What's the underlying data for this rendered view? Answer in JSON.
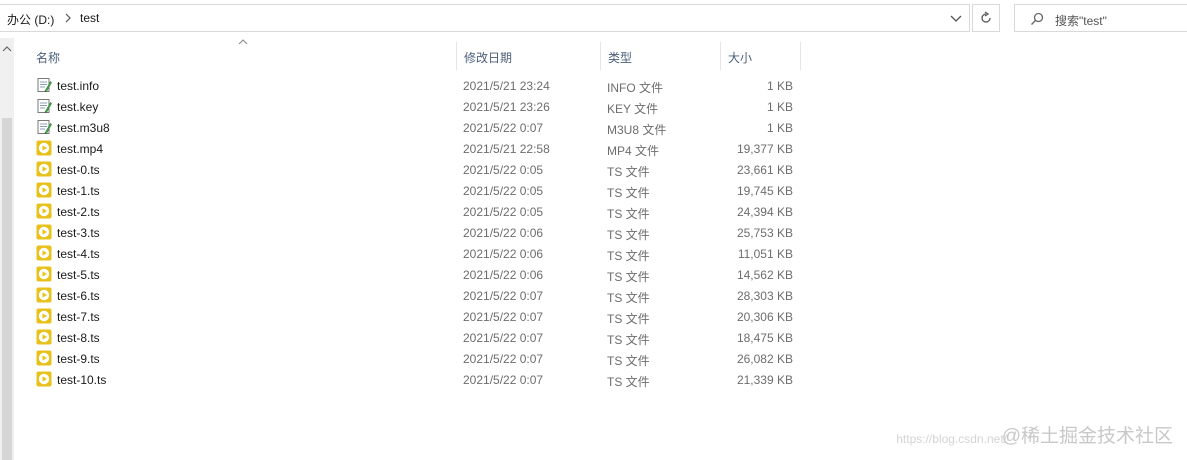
{
  "address_bar": {
    "crumbs": [
      "办公 (D:)",
      "test"
    ]
  },
  "search": {
    "placeholder": "搜索\"test\""
  },
  "columns": {
    "name": "名称",
    "date": "修改日期",
    "type": "类型",
    "size": "大小"
  },
  "files": [
    {
      "name": "test.info",
      "date": "2021/5/21 23:24",
      "type": "INFO 文件",
      "size": "1 KB",
      "icon": "text-file-icon"
    },
    {
      "name": "test.key",
      "date": "2021/5/21 23:26",
      "type": "KEY 文件",
      "size": "1 KB",
      "icon": "text-file-icon"
    },
    {
      "name": "test.m3u8",
      "date": "2021/5/22 0:07",
      "type": "M3U8 文件",
      "size": "1 KB",
      "icon": "text-file-icon"
    },
    {
      "name": "test.mp4",
      "date": "2021/5/21 22:58",
      "type": "MP4 文件",
      "size": "19,377 KB",
      "icon": "video-file-icon"
    },
    {
      "name": "test-0.ts",
      "date": "2021/5/22 0:05",
      "type": "TS 文件",
      "size": "23,661 KB",
      "icon": "video-file-icon"
    },
    {
      "name": "test-1.ts",
      "date": "2021/5/22 0:05",
      "type": "TS 文件",
      "size": "19,745 KB",
      "icon": "video-file-icon"
    },
    {
      "name": "test-2.ts",
      "date": "2021/5/22 0:05",
      "type": "TS 文件",
      "size": "24,394 KB",
      "icon": "video-file-icon"
    },
    {
      "name": "test-3.ts",
      "date": "2021/5/22 0:06",
      "type": "TS 文件",
      "size": "25,753 KB",
      "icon": "video-file-icon"
    },
    {
      "name": "test-4.ts",
      "date": "2021/5/22 0:06",
      "type": "TS 文件",
      "size": "11,051 KB",
      "icon": "video-file-icon"
    },
    {
      "name": "test-5.ts",
      "date": "2021/5/22 0:06",
      "type": "TS 文件",
      "size": "14,562 KB",
      "icon": "video-file-icon"
    },
    {
      "name": "test-6.ts",
      "date": "2021/5/22 0:07",
      "type": "TS 文件",
      "size": "28,303 KB",
      "icon": "video-file-icon"
    },
    {
      "name": "test-7.ts",
      "date": "2021/5/22 0:07",
      "type": "TS 文件",
      "size": "20,306 KB",
      "icon": "video-file-icon"
    },
    {
      "name": "test-8.ts",
      "date": "2021/5/22 0:07",
      "type": "TS 文件",
      "size": "18,475 KB",
      "icon": "video-file-icon"
    },
    {
      "name": "test-9.ts",
      "date": "2021/5/22 0:07",
      "type": "TS 文件",
      "size": "26,082 KB",
      "icon": "video-file-icon"
    },
    {
      "name": "test-10.ts",
      "date": "2021/5/22 0:07",
      "type": "TS 文件",
      "size": "21,339 KB",
      "icon": "video-file-icon"
    }
  ],
  "watermark": {
    "text": "@稀土掘金技术社区",
    "url": "https://blog.csdn.net/"
  },
  "colors": {
    "header_text": "#4c607a",
    "meta_text": "#6d6d6d",
    "video_icon": "#e8c21a"
  }
}
